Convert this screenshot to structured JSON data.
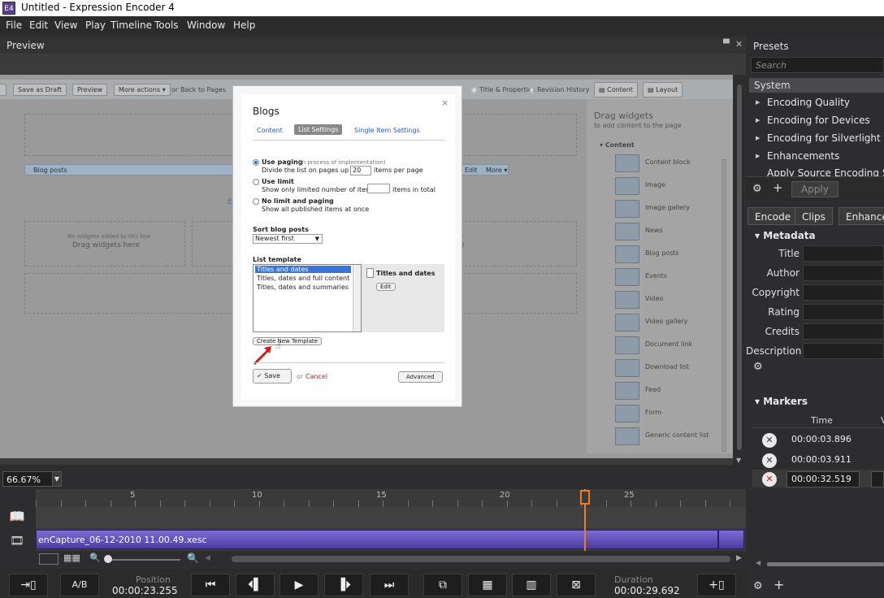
{
  "window": {
    "title": "Untitled - Expression Encoder 4",
    "icon": "E4"
  },
  "menu": [
    "File",
    "Edit",
    "View",
    "Play",
    "Timeline",
    "Tools",
    "Window",
    "Help"
  ],
  "preview": {
    "header": "Preview",
    "zoom": "66.67%",
    "page_toolbar": {
      "save_draft": "Save as Draft",
      "preview": "Preview",
      "more_actions": "More actions ▾",
      "or": "or",
      "back": "Back to Pages",
      "title_props": "Title & Properties",
      "revision": "Revision History",
      "content": "Content",
      "layout": "Layout"
    },
    "blog_posts_bar": "Blog posts",
    "edit": "Edit",
    "more": "More ▾",
    "no_widgets": "No widgets added to this box",
    "drag_here": "Drag widgets here",
    "widgets_panel": {
      "title": "Drag widgets",
      "subtitle": "to add content to the page",
      "section": "Content",
      "items": [
        "Content block",
        "Image",
        "Image gallery",
        "News",
        "Blog posts",
        "Events",
        "Video",
        "Video gallery",
        "Document link",
        "Download list",
        "Feed",
        "Form",
        "Generic content list"
      ]
    }
  },
  "dialog": {
    "title": "Blogs",
    "close": "×",
    "tabs": [
      "Content",
      "List Settings",
      "Single Item Settings"
    ],
    "use_paging": "Use paging",
    "use_paging_note": "(in process of implementation)",
    "divide_text": "Divide the list on pages up to",
    "divide_value": "20",
    "items_per_page": "items per page",
    "use_limit": "Use limit",
    "limit_text": "Show only limited number of items:",
    "items_total": "items in total",
    "no_limit": "No limit and paging",
    "no_limit_text": "Show all published items at once",
    "sort_label": "Sort blog posts",
    "sort_value": "Newest first",
    "template_label": "List template",
    "templates": [
      "Titles and dates",
      "Titles, dates and full content",
      "Titles, dates and summaries"
    ],
    "preview_name": "Titles and dates",
    "edit_btn": "Edit",
    "create_btn": "Create New Template",
    "save": "Save",
    "or": "or",
    "cancel": "Cancel",
    "advanced": "Advanced"
  },
  "presets": {
    "header": "Presets",
    "search_placeholder": "Search",
    "group": "System",
    "items": [
      "Encoding Quality",
      "Encoding for Devices",
      "Encoding for Silverlight",
      "Enhancements",
      "Apply Source Encoding Setti"
    ],
    "apply": "Apply"
  },
  "tabs": [
    "Encode",
    "Clips",
    "Enhance"
  ],
  "metadata": {
    "header": "Metadata",
    "fields": [
      "Title",
      "Author",
      "Copyright",
      "Rating",
      "Credits",
      "Description"
    ]
  },
  "markers": {
    "header": "Markers",
    "col_time": "Time",
    "col_v": "V",
    "rows": [
      "00:00:03.896",
      "00:00:03.911",
      "00:00:32.519"
    ]
  },
  "timeline": {
    "ticks": [
      "5",
      "10",
      "15",
      "20",
      "25"
    ],
    "clip_name": "enCapture_06-12-2010 11.00.49.xesc",
    "ab": "A/B",
    "position_label": "Position",
    "position": "00:00:23.255",
    "duration_label": "Duration",
    "duration": "00:00:29.692"
  }
}
